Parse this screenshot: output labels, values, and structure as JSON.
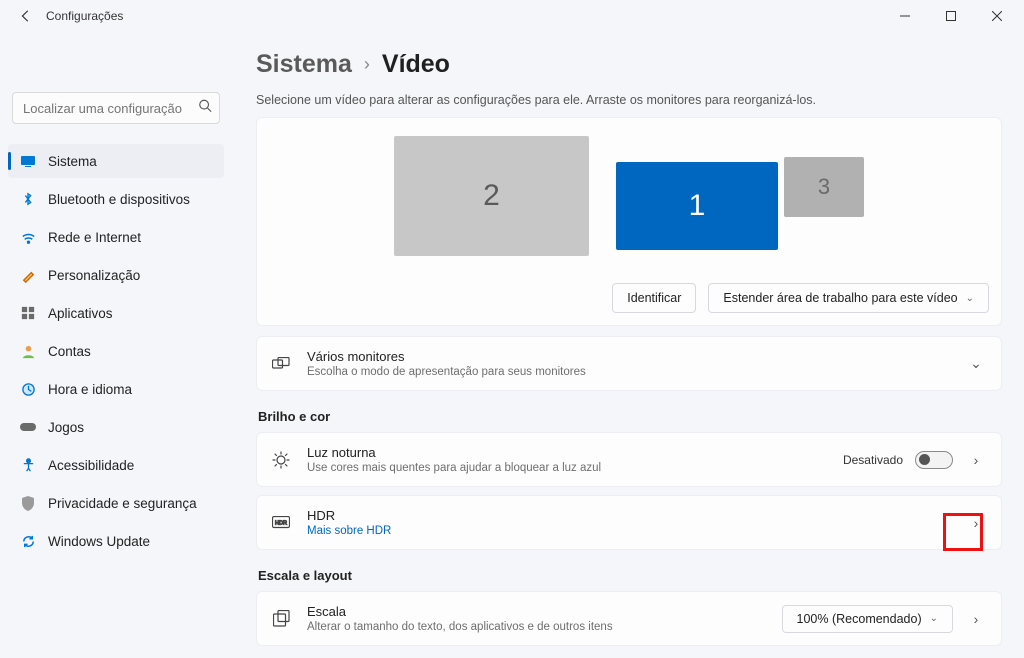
{
  "window": {
    "title": "Configurações"
  },
  "search": {
    "placeholder": "Localizar uma configuração"
  },
  "nav": {
    "items": [
      {
        "label": "Sistema"
      },
      {
        "label": "Bluetooth e dispositivos"
      },
      {
        "label": "Rede e Internet"
      },
      {
        "label": "Personalização"
      },
      {
        "label": "Aplicativos"
      },
      {
        "label": "Contas"
      },
      {
        "label": "Hora e idioma"
      },
      {
        "label": "Jogos"
      },
      {
        "label": "Acessibilidade"
      },
      {
        "label": "Privacidade e segurança"
      },
      {
        "label": "Windows Update"
      }
    ]
  },
  "breadcrumb": {
    "parent": "Sistema",
    "current": "Vídeo"
  },
  "subtitle": "Selecione um vídeo para alterar as configurações para ele. Arraste os monitores para reorganizá-los.",
  "monitors": {
    "m1": "1",
    "m2": "2",
    "m3": "3"
  },
  "actions": {
    "identify": "Identificar",
    "extend": "Estender área de trabalho para este vídeo"
  },
  "multi": {
    "title": "Vários monitores",
    "sub": "Escolha o modo de apresentação para seus monitores"
  },
  "sections": {
    "brightness": "Brilho e cor",
    "scale": "Escala e layout"
  },
  "nightlight": {
    "title": "Luz noturna",
    "sub": "Use cores mais quentes para ajudar a bloquear a luz azul",
    "state": "Desativado"
  },
  "hdr": {
    "title": "HDR",
    "sub": "Mais sobre HDR"
  },
  "scale_row": {
    "title": "Escala",
    "sub": "Alterar o tamanho do texto, dos aplicativos e de outros itens",
    "value": "100% (Recomendado)"
  }
}
